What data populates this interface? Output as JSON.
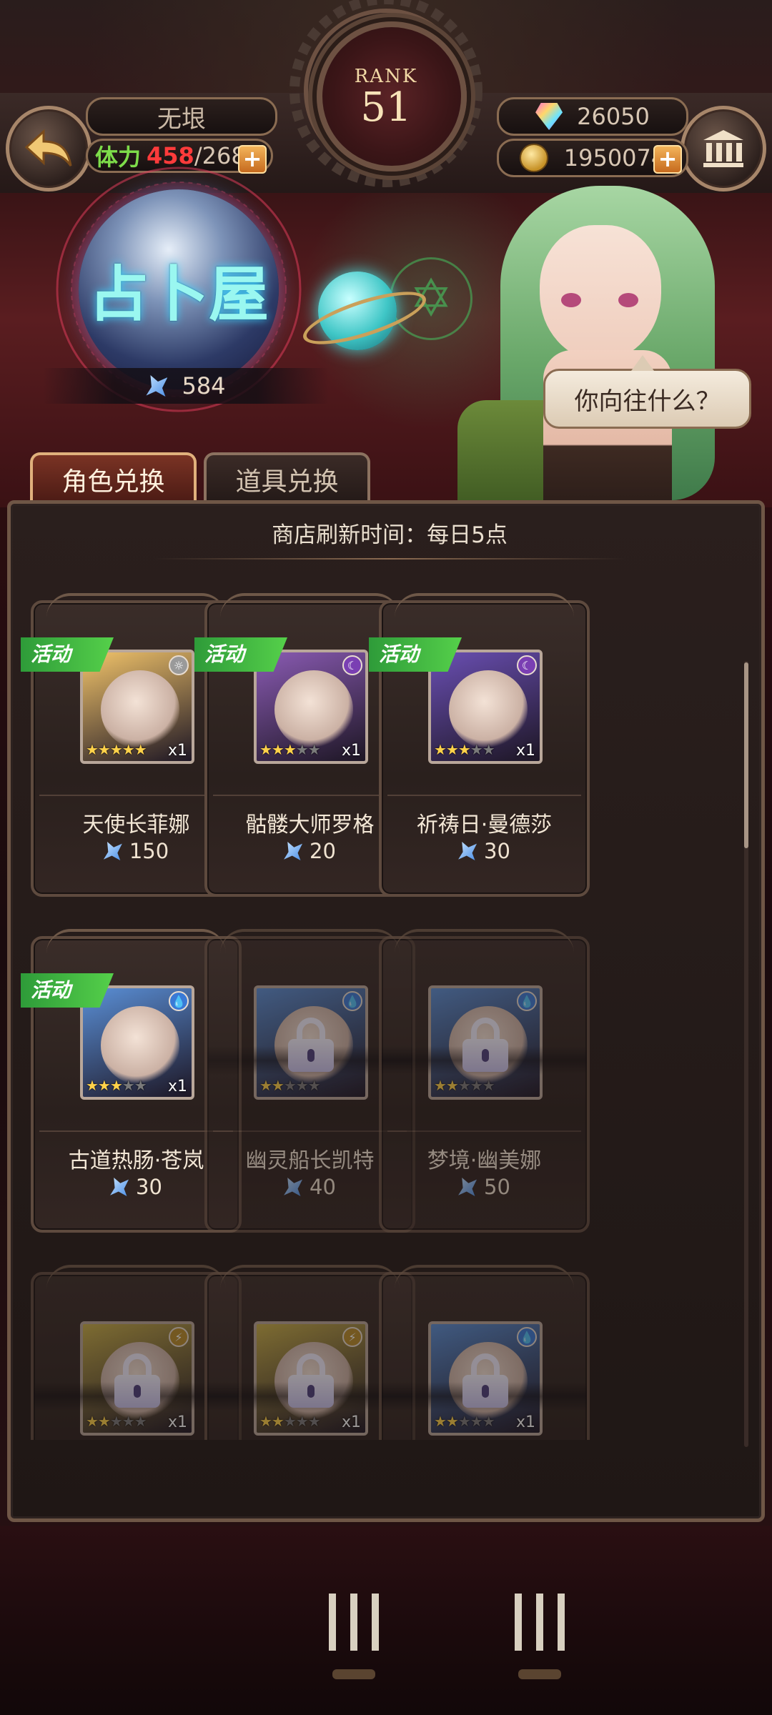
{
  "hud": {
    "player_name": "无垠",
    "stamina": {
      "label": "体力",
      "current": "458",
      "separator": "/",
      "max": "268"
    },
    "rank": {
      "label": "RANK",
      "value": "51"
    },
    "gems": "26050",
    "gold": "1950074",
    "plus_symbol": "+",
    "icons": {
      "back": "back-arrow-icon",
      "menu": "temple-icon",
      "gem": "diamond-icon",
      "gold": "coin-icon"
    }
  },
  "shop": {
    "title": "占卜屋",
    "currency_balance": "584",
    "npc_speech": "你向往什么？",
    "tabs": [
      {
        "label": "角色兑换",
        "active": true
      },
      {
        "label": "道具兑换",
        "active": false
      }
    ],
    "refresh_notice": "商店刷新时间：每日5点"
  },
  "items": [
    {
      "name": "天使长菲娜",
      "price": "150",
      "badge": "活动",
      "stars": 5,
      "qty": "x1",
      "element": "light",
      "locked": false,
      "accent": "#f2c46a"
    },
    {
      "name": "骷髅大师罗格",
      "price": "20",
      "badge": "活动",
      "stars": 3,
      "qty": "x1",
      "element": "dark",
      "locked": false,
      "accent": "#8a5bb3"
    },
    {
      "name": "祈祷日·曼德莎",
      "price": "30",
      "badge": "活动",
      "stars": 3,
      "qty": "x1",
      "element": "dark",
      "locked": false,
      "accent": "#6a4fb3"
    },
    {
      "name": "古道热肠·苍岚",
      "price": "30",
      "badge": "活动",
      "stars": 3,
      "qty": "x1",
      "element": "water",
      "locked": false,
      "accent": "#5a8fd6"
    },
    {
      "name": "幽灵船长凯特",
      "price": "40",
      "badge": "",
      "stars": 2,
      "qty": "",
      "element": "water",
      "locked": true,
      "accent": "#5a8fd6"
    },
    {
      "name": "梦境·幽美娜",
      "price": "50",
      "badge": "",
      "stars": 2,
      "qty": "",
      "element": "water",
      "locked": true,
      "accent": "#5a8fd6"
    },
    {
      "name": "",
      "price": "",
      "badge": "",
      "stars": 2,
      "qty": "x1",
      "element": "thunder",
      "locked": true,
      "accent": "#c9b04a"
    },
    {
      "name": "",
      "price": "",
      "badge": "",
      "stars": 2,
      "qty": "x1",
      "element": "thunder",
      "locked": true,
      "accent": "#c9b04a"
    },
    {
      "name": "",
      "price": "",
      "badge": "",
      "stars": 2,
      "qty": "x1",
      "element": "water",
      "locked": true,
      "accent": "#5a8fd6"
    }
  ],
  "colors": {
    "stamina_current": "#ff3b3b",
    "event_badge": "#3fbf3f",
    "accent_gold": "#e0b07c"
  }
}
